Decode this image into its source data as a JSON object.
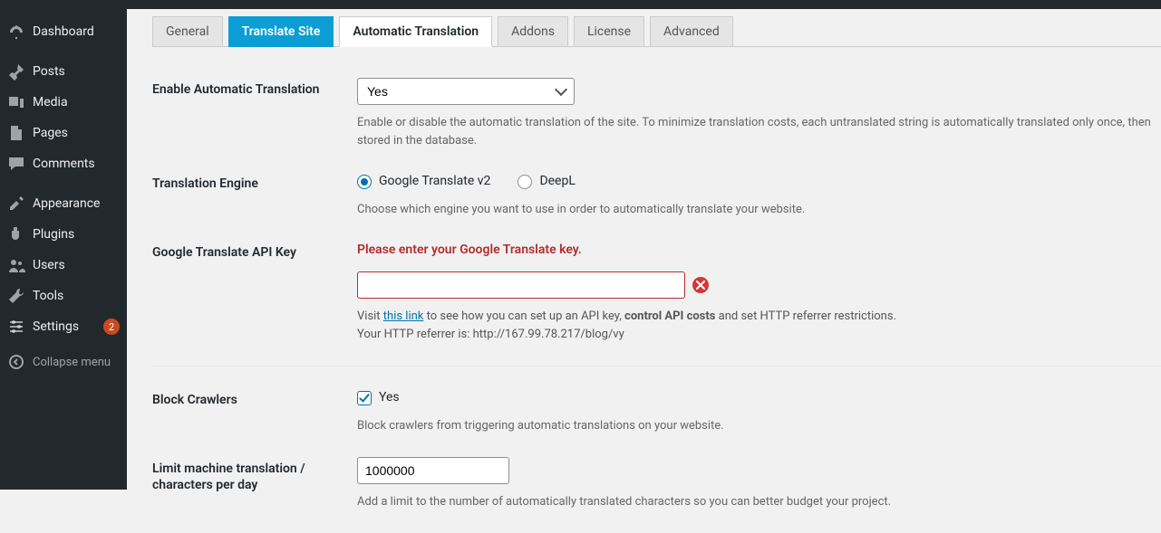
{
  "sidebar": {
    "items": [
      {
        "label": "Dashboard",
        "icon": "dashboard"
      },
      {
        "label": "Posts",
        "icon": "pin"
      },
      {
        "label": "Media",
        "icon": "media"
      },
      {
        "label": "Pages",
        "icon": "page"
      },
      {
        "label": "Comments",
        "icon": "comment"
      },
      {
        "label": "Appearance",
        "icon": "appearance"
      },
      {
        "label": "Plugins",
        "icon": "plugin"
      },
      {
        "label": "Users",
        "icon": "users"
      },
      {
        "label": "Tools",
        "icon": "tools"
      },
      {
        "label": "Settings",
        "icon": "settings",
        "badge": "2"
      },
      {
        "label": "Collapse menu",
        "icon": "collapse"
      }
    ]
  },
  "tabs": [
    {
      "label": "General"
    },
    {
      "label": "Translate Site"
    },
    {
      "label": "Automatic Translation"
    },
    {
      "label": "Addons"
    },
    {
      "label": "License"
    },
    {
      "label": "Advanced"
    }
  ],
  "form": {
    "enable": {
      "label": "Enable Automatic Translation",
      "value": "Yes",
      "desc": "Enable or disable the automatic translation of the site. To minimize translation costs, each untranslated string is automatically translated only once, then stored in the database."
    },
    "engine": {
      "label": "Translation Engine",
      "options": [
        {
          "label": "Google Translate v2",
          "checked": true
        },
        {
          "label": "DeepL",
          "checked": false
        }
      ],
      "desc": "Choose which engine you want to use in order to automatically translate your website."
    },
    "apikey": {
      "label": "Google Translate API Key",
      "error": "Please enter your Google Translate key.",
      "value": "",
      "help_prefix": "Visit ",
      "help_link_text": "this link",
      "help_mid": " to see how you can set up an API key, ",
      "help_bold": "control API costs",
      "help_suffix": " and set HTTP referrer restrictions.",
      "referrer_label": "Your HTTP referrer is: ",
      "referrer_value": "http://167.99.78.217/blog/vy"
    },
    "block": {
      "label": "Block Crawlers",
      "checkbox_label": "Yes",
      "desc": "Block crawlers from triggering automatic translations on your website."
    },
    "limit": {
      "label": "Limit machine translation / characters per day",
      "value": "1000000",
      "desc": "Add a limit to the number of automatically translated characters so you can better budget your project."
    }
  }
}
